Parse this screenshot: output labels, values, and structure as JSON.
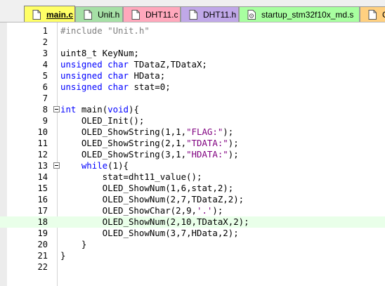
{
  "tabs": [
    {
      "label": "main.c",
      "active": true,
      "color": "#ffff66"
    },
    {
      "label": "Unit.h",
      "active": false,
      "color": "#a6e0a6"
    },
    {
      "label": "DHT11.c",
      "active": false,
      "color": "#ffa8bc"
    },
    {
      "label": "DHT11.h",
      "active": false,
      "color": "#c0a8e8"
    },
    {
      "label": "startup_stm32f10x_md.s",
      "active": false,
      "color": "#a8ffa0"
    },
    {
      "label": "C",
      "active": false,
      "color": "#ffd080"
    }
  ],
  "highlighted_line": 18,
  "lines": [
    {
      "num": "1",
      "segments": [
        {
          "t": "#include \"Unit.h\"",
          "c": "pp"
        }
      ]
    },
    {
      "num": "2",
      "segments": []
    },
    {
      "num": "3",
      "segments": [
        {
          "t": "uint8_t KeyNum;",
          "c": ""
        }
      ]
    },
    {
      "num": "4",
      "segments": [
        {
          "t": "unsigned",
          "c": "kw"
        },
        {
          "t": " ",
          "c": ""
        },
        {
          "t": "char",
          "c": "kw"
        },
        {
          "t": " TDataZ,TDataX;",
          "c": ""
        }
      ]
    },
    {
      "num": "5",
      "segments": [
        {
          "t": "unsigned",
          "c": "kw"
        },
        {
          "t": " ",
          "c": ""
        },
        {
          "t": "char",
          "c": "kw"
        },
        {
          "t": " HData;",
          "c": ""
        }
      ]
    },
    {
      "num": "6",
      "segments": [
        {
          "t": "unsigned",
          "c": "kw"
        },
        {
          "t": " ",
          "c": ""
        },
        {
          "t": "char",
          "c": "kw"
        },
        {
          "t": " stat=",
          "c": ""
        },
        {
          "t": "0",
          "c": "num"
        },
        {
          "t": ";",
          "c": ""
        }
      ]
    },
    {
      "num": "7",
      "segments": []
    },
    {
      "num": "8",
      "fold": true,
      "segments": [
        {
          "t": "int",
          "c": "kw"
        },
        {
          "t": " main(",
          "c": ""
        },
        {
          "t": "void",
          "c": "kw"
        },
        {
          "t": "){",
          "c": ""
        }
      ]
    },
    {
      "num": "9",
      "segments": [
        {
          "t": "    OLED_Init();",
          "c": ""
        }
      ]
    },
    {
      "num": "10",
      "segments": [
        {
          "t": "    OLED_ShowString(",
          "c": ""
        },
        {
          "t": "1",
          "c": "num"
        },
        {
          "t": ",",
          "c": ""
        },
        {
          "t": "1",
          "c": "num"
        },
        {
          "t": ",",
          "c": ""
        },
        {
          "t": "\"FLAG:\"",
          "c": "str"
        },
        {
          "t": ");",
          "c": ""
        }
      ]
    },
    {
      "num": "11",
      "segments": [
        {
          "t": "    OLED_ShowString(",
          "c": ""
        },
        {
          "t": "2",
          "c": "num"
        },
        {
          "t": ",",
          "c": ""
        },
        {
          "t": "1",
          "c": "num"
        },
        {
          "t": ",",
          "c": ""
        },
        {
          "t": "\"TDATA:\"",
          "c": "str"
        },
        {
          "t": ");",
          "c": ""
        }
      ]
    },
    {
      "num": "12",
      "segments": [
        {
          "t": "    OLED_ShowString(",
          "c": ""
        },
        {
          "t": "3",
          "c": "num"
        },
        {
          "t": ",",
          "c": ""
        },
        {
          "t": "1",
          "c": "num"
        },
        {
          "t": ",",
          "c": ""
        },
        {
          "t": "\"HDATA:\"",
          "c": "str"
        },
        {
          "t": ");",
          "c": ""
        }
      ]
    },
    {
      "num": "13",
      "fold": true,
      "segments": [
        {
          "t": "    ",
          "c": ""
        },
        {
          "t": "while",
          "c": "kw"
        },
        {
          "t": "(",
          "c": ""
        },
        {
          "t": "1",
          "c": "num"
        },
        {
          "t": "){",
          "c": ""
        }
      ]
    },
    {
      "num": "14",
      "segments": [
        {
          "t": "        stat=dht11_value();",
          "c": ""
        }
      ]
    },
    {
      "num": "15",
      "segments": [
        {
          "t": "        OLED_ShowNum(",
          "c": ""
        },
        {
          "t": "1",
          "c": "num"
        },
        {
          "t": ",",
          "c": ""
        },
        {
          "t": "6",
          "c": "num"
        },
        {
          "t": ",stat,",
          "c": ""
        },
        {
          "t": "2",
          "c": "num"
        },
        {
          "t": ");",
          "c": ""
        }
      ]
    },
    {
      "num": "16",
      "segments": [
        {
          "t": "        OLED_ShowNum(",
          "c": ""
        },
        {
          "t": "2",
          "c": "num"
        },
        {
          "t": ",",
          "c": ""
        },
        {
          "t": "7",
          "c": "num"
        },
        {
          "t": ",TDataZ,",
          "c": ""
        },
        {
          "t": "2",
          "c": "num"
        },
        {
          "t": ");",
          "c": ""
        }
      ]
    },
    {
      "num": "17",
      "segments": [
        {
          "t": "        OLED_ShowChar(",
          "c": ""
        },
        {
          "t": "2",
          "c": "num"
        },
        {
          "t": ",",
          "c": ""
        },
        {
          "t": "9",
          "c": "num"
        },
        {
          "t": ",",
          "c": ""
        },
        {
          "t": "'.'",
          "c": "str"
        },
        {
          "t": ");",
          "c": ""
        }
      ]
    },
    {
      "num": "18",
      "segments": [
        {
          "t": "        OLED_ShowNum(",
          "c": ""
        },
        {
          "t": "2",
          "c": "num"
        },
        {
          "t": ",",
          "c": ""
        },
        {
          "t": "10",
          "c": "num"
        },
        {
          "t": ",TDataX,",
          "c": ""
        },
        {
          "t": "2",
          "c": "num"
        },
        {
          "t": ");",
          "c": ""
        }
      ]
    },
    {
      "num": "19",
      "segments": [
        {
          "t": "        OLED_ShowNum(",
          "c": ""
        },
        {
          "t": "3",
          "c": "num"
        },
        {
          "t": ",",
          "c": ""
        },
        {
          "t": "7",
          "c": "num"
        },
        {
          "t": ",HData,",
          "c": ""
        },
        {
          "t": "2",
          "c": "num"
        },
        {
          "t": ");",
          "c": ""
        }
      ]
    },
    {
      "num": "20",
      "segments": [
        {
          "t": "    }",
          "c": ""
        }
      ]
    },
    {
      "num": "21",
      "segments": [
        {
          "t": "}",
          "c": ""
        }
      ]
    },
    {
      "num": "22",
      "segments": []
    }
  ]
}
